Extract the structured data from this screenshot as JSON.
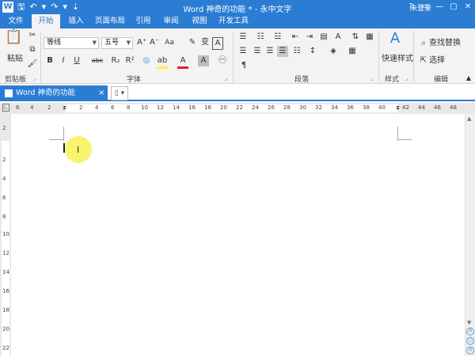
{
  "titlebar": {
    "app_icon": "W",
    "title": "Word 神奇的功能 * - 永中文字",
    "login": "未登录",
    "qat_icons": [
      "save-icon",
      "undo-icon",
      "redo-icon",
      "customize-icon"
    ],
    "controls": [
      "?",
      "▭",
      "—",
      "▢",
      "✕"
    ]
  },
  "tabs": {
    "items": [
      {
        "label": "文件"
      },
      {
        "label": "开始"
      },
      {
        "label": "插入"
      },
      {
        "label": "页面布局"
      },
      {
        "label": "引用"
      },
      {
        "label": "审阅"
      },
      {
        "label": "视图"
      },
      {
        "label": "开发工具"
      }
    ],
    "active": "开始"
  },
  "ribbon": {
    "clipboard": {
      "label": "剪贴板",
      "paste": "粘贴"
    },
    "font": {
      "label": "字体",
      "font_name": "等线",
      "font_size": "五号",
      "bold": "B",
      "italic": "I",
      "underline": "U",
      "strike": "abc",
      "subscript": "R₂",
      "superscript": "R²",
      "grow": "A⁺",
      "shrink": "A⁻",
      "case": "Aa",
      "highlight": "ab",
      "fontcolor": "A",
      "shade": "A",
      "phonetic": "变"
    },
    "paragraph": {
      "label": "段落",
      "marks": "¶"
    },
    "styles": {
      "label": "样式",
      "quick": "快速样式"
    },
    "editing": {
      "label": "编辑",
      "find_replace": "查找替换",
      "select": "选择"
    }
  },
  "document": {
    "tab_label": "Word 神奇的功能",
    "close": "×"
  },
  "ruler": {
    "h_labels": [
      "6",
      "4",
      "2",
      "",
      "2",
      "4",
      "6",
      "8",
      "10",
      "12",
      "14",
      "16",
      "18",
      "20",
      "22",
      "24",
      "26",
      "28",
      "30",
      "32",
      "34",
      "36",
      "38",
      "40",
      "42",
      "44",
      "46",
      "48"
    ],
    "v_labels": [
      "2",
      "",
      "2",
      "4",
      "6",
      "8",
      "10",
      "12",
      "14",
      "16",
      "18",
      "20",
      "22"
    ]
  },
  "scrollbar": {
    "page_up": "∧",
    "page_down": "∨",
    "prev": "0",
    "next": "0"
  }
}
